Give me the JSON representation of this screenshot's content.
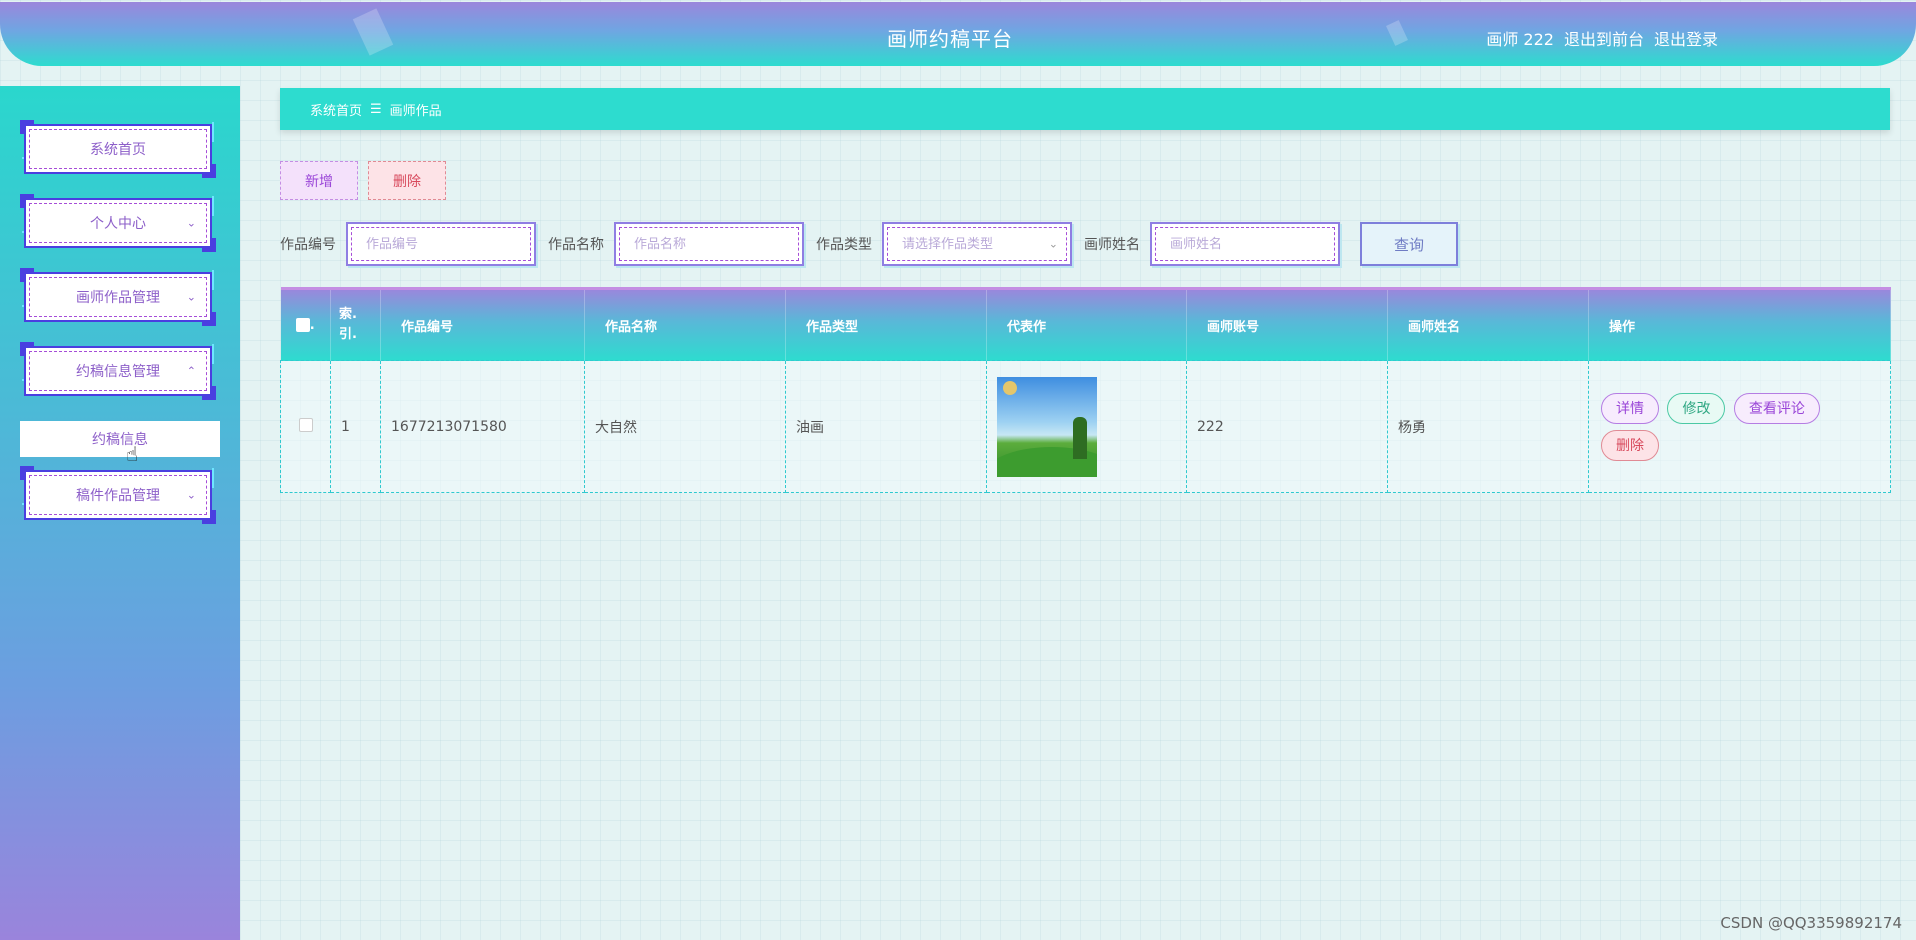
{
  "header": {
    "title": "画师约稿平台",
    "user": "画师 222",
    "to_front": "退出到前台",
    "logout": "退出登录"
  },
  "sidebar": {
    "items": [
      {
        "label": "系统首页",
        "chevron": ""
      },
      {
        "label": "个人中心",
        "chevron": "chevron-down-icon"
      },
      {
        "label": "画师作品管理",
        "chevron": "chevron-down-icon"
      },
      {
        "label": "约稿信息管理",
        "chevron": "chevron-up-icon"
      },
      {
        "label": "稿件作品管理",
        "chevron": "chevron-down-icon"
      }
    ],
    "submenu": "约稿信息"
  },
  "breadcrumb": {
    "home": "系统首页",
    "separator": "☰",
    "current": "画师作品"
  },
  "actions": {
    "add": "新增",
    "delete": "删除"
  },
  "search": {
    "fields": [
      {
        "label": "作品编号",
        "placeholder": "作品编号"
      },
      {
        "label": "作品名称",
        "placeholder": "作品名称"
      },
      {
        "label": "作品类型",
        "placeholder": "请选择作品类型"
      },
      {
        "label": "画师姓名",
        "placeholder": "画师姓名"
      }
    ],
    "button": "查询"
  },
  "table": {
    "columns": [
      "索引",
      "作品编号",
      "作品名称",
      "作品类型",
      "代表作",
      "画师账号",
      "画师姓名",
      "操作"
    ],
    "index_header_line1": "索.",
    "index_header_line2": "引.",
    "rows": [
      {
        "index": "1",
        "code": "1677213071580",
        "name": "大自然",
        "type": "油画",
        "account": "222",
        "artist": "杨勇"
      }
    ],
    "ops": {
      "detail": "详情",
      "edit": "修改",
      "comments": "查看评论",
      "delete": "删除"
    }
  },
  "watermark": "CSDN @QQ3359892174",
  "colors": {
    "accent": "#2ddccf",
    "purple": "#9b86dc",
    "menu_border": "#4a3fe0"
  }
}
